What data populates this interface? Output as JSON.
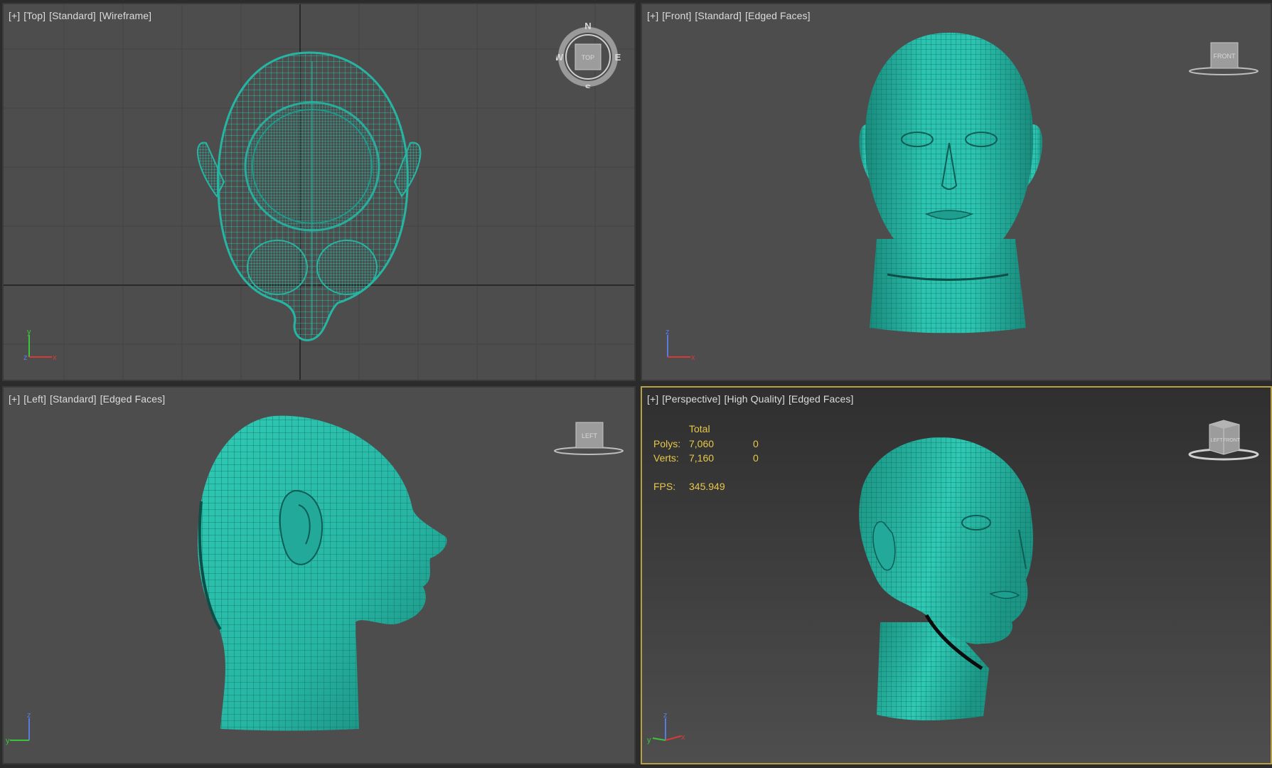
{
  "viewports": {
    "top": {
      "plus": "[+]",
      "view": "[Top]",
      "shading": "[Standard]",
      "mode": "[Wireframe]"
    },
    "front": {
      "plus": "[+]",
      "view": "[Front]",
      "shading": "[Standard]",
      "mode": "[Edged Faces]"
    },
    "left": {
      "plus": "[+]",
      "view": "[Left]",
      "shading": "[Standard]",
      "mode": "[Edged Faces]"
    },
    "persp": {
      "plus": "[+]",
      "view": "[Perspective]",
      "shading": "[High Quality]",
      "mode": "[Edged Faces]"
    }
  },
  "stats": {
    "header": "Total",
    "polys_label": "Polys:",
    "polys_value": "7,060",
    "polys_sel": "0",
    "verts_label": "Verts:",
    "verts_value": "7,160",
    "verts_sel": "0",
    "fps_label": "FPS:",
    "fps_value": "345.949"
  },
  "viewcube": {
    "top": "TOP",
    "front": "FRONT",
    "left": "LEFT",
    "persp_left": "LEFT",
    "persp_front": "FRONT",
    "compass": {
      "n": "N",
      "s": "S",
      "e": "E",
      "w": "W"
    }
  },
  "axis_labels": {
    "x": "x",
    "y": "y",
    "z": "z"
  },
  "colors": {
    "mesh": "#27b5a3",
    "mesh_dark": "#0f6f64",
    "grid": "#3a3a3a",
    "active_border": "#b8a046",
    "stats_text": "#e8c84a"
  },
  "icons": [
    "viewcube-compass-icon",
    "viewcube-icon",
    "axis-tripod-icon",
    "head-mesh"
  ]
}
